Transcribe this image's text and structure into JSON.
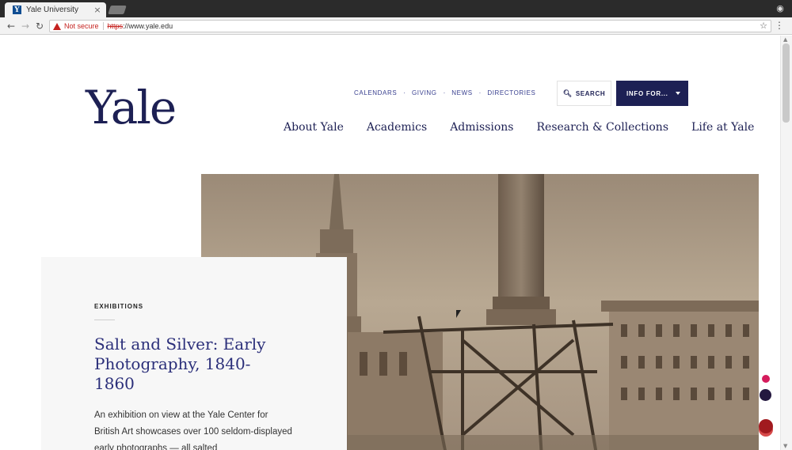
{
  "browser": {
    "tab_title": "Yale University",
    "tab_favicon": "Y",
    "close_glyph": "×",
    "security_label": "Not secure",
    "url_scheme": "https",
    "url_rest": "://www.yale.edu",
    "icons": [
      "back-icon",
      "forward-icon",
      "reload-icon",
      "warning-icon",
      "star-icon",
      "menu-icon",
      "incognito-icon"
    ]
  },
  "header": {
    "logo": "Yale",
    "utility_links": [
      "CALENDARS",
      "GIVING",
      "NEWS",
      "DIRECTORIES"
    ],
    "separator": "·",
    "search_label": "SEARCH",
    "info_label": "INFO FOR...",
    "main_nav": [
      "About Yale",
      "Academics",
      "Admissions",
      "Research & Collections",
      "Life at Yale"
    ]
  },
  "feature": {
    "kicker": "EXHIBITIONS",
    "title": "Salt and Silver: Early Photography, 1840-1860",
    "description": "An exhibition on view at the Yale Center for British Art showcases over 100 seldom-displayed early photographs — all salted"
  },
  "colors": {
    "brand_navy": "#1d2054",
    "link_blue": "#3a4190",
    "warning_red": "#c5221f",
    "dot_pink": "#d51b5c",
    "dot_dark": "#24183f",
    "dot_red": "#a11a1f"
  }
}
